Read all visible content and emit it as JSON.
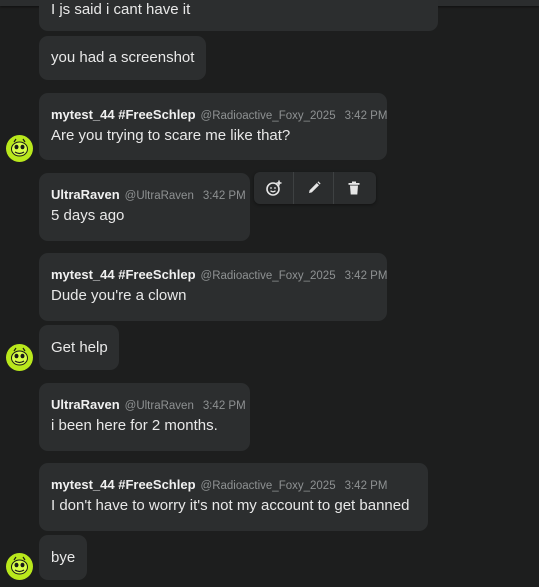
{
  "messages": [
    {
      "text": "I js said i cant have it"
    },
    {
      "text": "you had a screenshot"
    },
    {
      "author": "mytest_44 #FreeSchlep",
      "handle": "@Radioactive_Foxy_2025",
      "time": "3:42 PM",
      "text": "Are you trying to scare me like that?"
    },
    {
      "author": "UltraRaven",
      "handle": "@UltraRaven",
      "time": "3:42 PM",
      "text": "5 days ago"
    },
    {
      "author": "mytest_44 #FreeSchlep",
      "handle": "@Radioactive_Foxy_2025",
      "time": "3:42 PM",
      "text": "Dude you're a clown"
    },
    {
      "text": "Get help"
    },
    {
      "author": "UltraRaven",
      "handle": "@UltraRaven",
      "time": "3:42 PM",
      "text": "i been here for 2 months."
    },
    {
      "author": "mytest_44 #FreeSchlep",
      "handle": "@Radioactive_Foxy_2025",
      "time": "3:42 PM",
      "text": "I don't have to worry it's not my account to get banned"
    },
    {
      "text": "bye"
    }
  ],
  "toolbar": {
    "icons": [
      "add-reaction-icon",
      "pencil-icon",
      "trash-icon"
    ]
  },
  "colors": {
    "background": "#1d1e1e",
    "bubble": "#2c2e2f",
    "avatar": "#b9e81c",
    "muted_text": "#8e9192"
  }
}
